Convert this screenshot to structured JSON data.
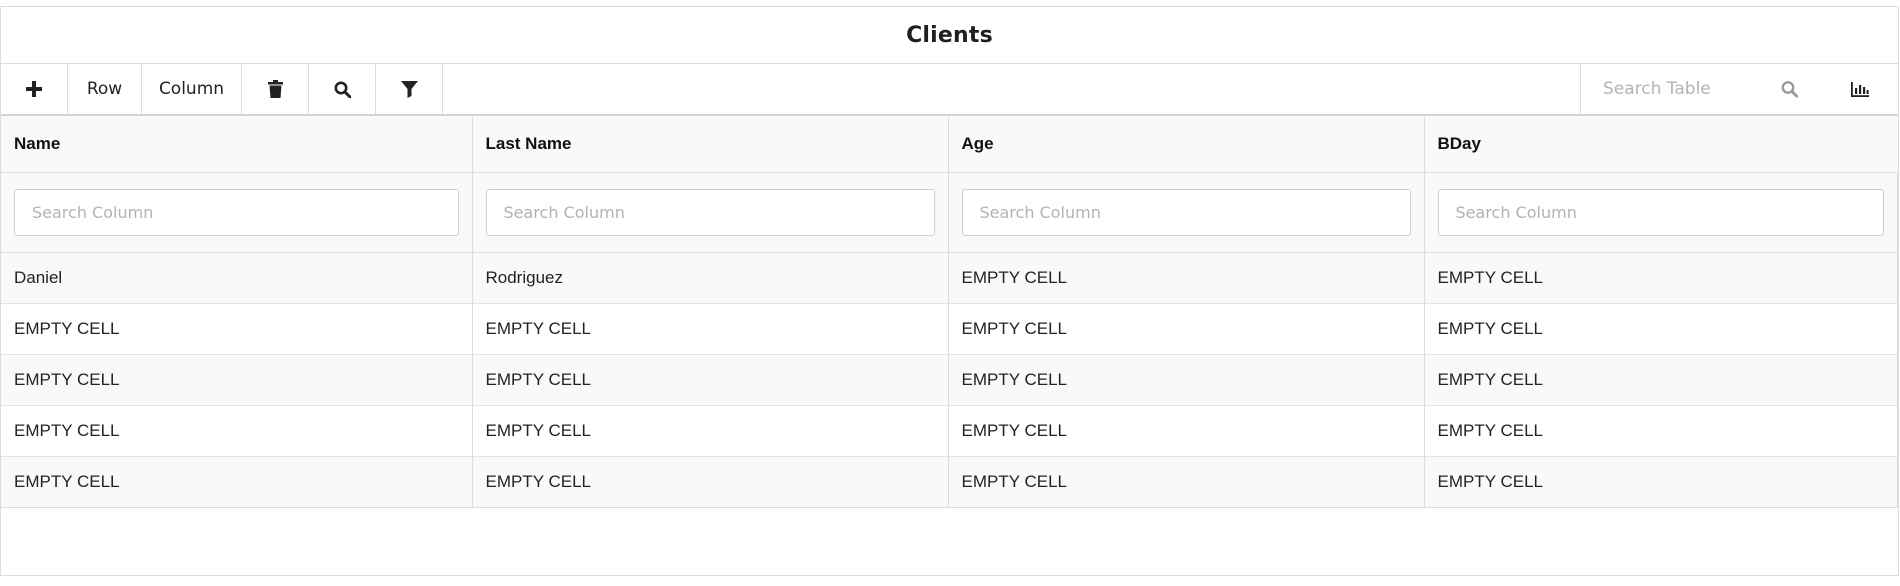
{
  "title": "Clients",
  "toolbar": {
    "add_icon": "plus-icon",
    "row_label": "Row",
    "column_label": "Column",
    "delete_icon": "trash-icon",
    "search_icon": "search-icon",
    "filter_icon": "filter-icon",
    "search_placeholder": "Search Table",
    "chart_icon": "bar-chart-icon"
  },
  "colors": {
    "border": "#dcdcdc",
    "header_bg": "#f8f9fa",
    "placeholder": "#b3b3b3",
    "text": "#222222"
  },
  "table": {
    "columns": [
      {
        "header": "Name",
        "filter_placeholder": "Search Column"
      },
      {
        "header": "Last Name",
        "filter_placeholder": "Search Column"
      },
      {
        "header": "Age",
        "filter_placeholder": "Search Column"
      },
      {
        "header": "BDay",
        "filter_placeholder": "Search Column"
      }
    ],
    "rows": [
      [
        "Daniel",
        "Rodriguez",
        "EMPTY CELL",
        "EMPTY CELL"
      ],
      [
        "EMPTY CELL",
        "EMPTY CELL",
        "EMPTY CELL",
        "EMPTY CELL"
      ],
      [
        "EMPTY CELL",
        "EMPTY CELL",
        "EMPTY CELL",
        "EMPTY CELL"
      ],
      [
        "EMPTY CELL",
        "EMPTY CELL",
        "EMPTY CELL",
        "EMPTY CELL"
      ],
      [
        "EMPTY CELL",
        "EMPTY CELL",
        "EMPTY CELL",
        "EMPTY CELL"
      ]
    ]
  }
}
